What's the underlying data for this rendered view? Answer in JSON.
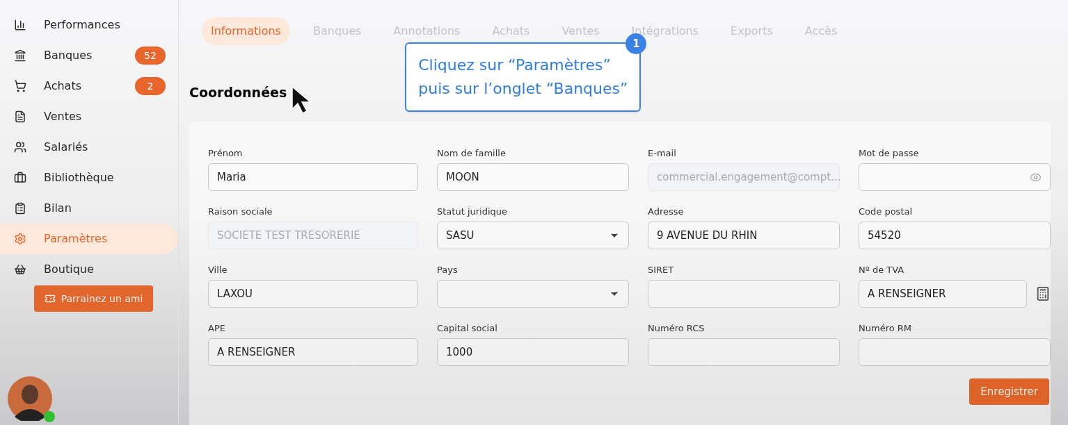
{
  "sidebar": {
    "items": [
      {
        "label": "Performances",
        "selected": false
      },
      {
        "label": "Banques",
        "selected": false,
        "badge": "52"
      },
      {
        "label": "Achats",
        "selected": false,
        "badge": "2"
      },
      {
        "label": "Ventes",
        "selected": false
      },
      {
        "label": "Salariés",
        "selected": false
      },
      {
        "label": "Bibliothèque",
        "selected": false
      },
      {
        "label": "Bilan",
        "selected": false
      },
      {
        "label": "Paramètres",
        "selected": true
      },
      {
        "label": "Boutique",
        "selected": false
      }
    ],
    "referral_button": "Parrainez un ami",
    "user": {
      "online": true
    }
  },
  "tabs": [
    {
      "label": "Informations",
      "selected": true
    },
    {
      "label": "Banques",
      "selected": false
    },
    {
      "label": "Annotations",
      "selected": false
    },
    {
      "label": "Achats",
      "selected": false
    },
    {
      "label": "Ventes",
      "selected": false
    },
    {
      "label": "Intégrations",
      "selected": false
    },
    {
      "label": "Exports",
      "selected": false
    },
    {
      "label": "Accès",
      "selected": false
    }
  ],
  "callout": {
    "step": "1",
    "lines": [
      "Cliquez sur “Paramètres”",
      "puis sur l’onglet “Banques”"
    ]
  },
  "section_title": "Coordonnées",
  "fields": [
    {
      "label": "Prénom",
      "kind": "text",
      "value": "Maria",
      "disabled": false
    },
    {
      "label": "Nom de famille",
      "kind": "text",
      "value": "MOON",
      "disabled": false
    },
    {
      "label": "E-mail",
      "kind": "text",
      "value": "commercial.engagement@compt…",
      "disabled": true
    },
    {
      "label": "Mot de passe",
      "kind": "password",
      "disabled": false
    },
    {
      "label": "Raison sociale",
      "kind": "text",
      "value": "SOCIETE TEST TRESORERIE",
      "disabled": true
    },
    {
      "label": "Statut juridique",
      "kind": "select",
      "value": "SASU",
      "disabled": false
    },
    {
      "label": "Adresse",
      "kind": "text",
      "value": "9 AVENUE DU RHIN",
      "disabled": false
    },
    {
      "label": "Code postal",
      "kind": "text",
      "value": "54520",
      "disabled": false
    },
    {
      "label": "Ville",
      "kind": "text",
      "value": "LAXOU",
      "disabled": false
    },
    {
      "label": "Pays",
      "kind": "select",
      "disabled": false
    },
    {
      "label": "SIRET",
      "kind": "text",
      "disabled": false
    },
    {
      "label": "Nº de TVA",
      "kind": "calculator",
      "value": "A RENSEIGNER",
      "disabled": false
    },
    {
      "label": "APE",
      "kind": "text",
      "value": "A RENSEIGNER",
      "disabled": false
    },
    {
      "label": "Capital social",
      "kind": "text",
      "value": "1000",
      "disabled": false
    },
    {
      "label": "Numéro RCS",
      "kind": "text",
      "disabled": false
    },
    {
      "label": "Numéro RM",
      "kind": "text",
      "disabled": false
    }
  ],
  "save_button": "Enregistrer"
}
